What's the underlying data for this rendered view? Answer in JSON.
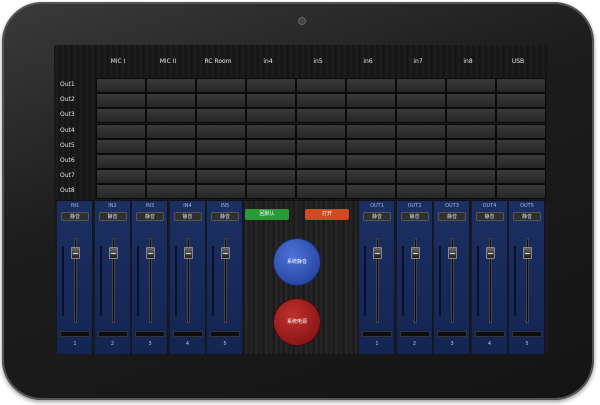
{
  "matrix": {
    "columns": [
      "MIC I",
      "MIC II",
      "RC Room",
      "in4",
      "in5",
      "in6",
      "in7",
      "in8",
      "USB"
    ],
    "rows": [
      "Out1",
      "Out2",
      "Out3",
      "Out4",
      "Out5",
      "Out6",
      "Out7",
      "Out8"
    ]
  },
  "inputs": [
    {
      "name": "IN1",
      "mute": "静音",
      "num": "1"
    },
    {
      "name": "IN2",
      "mute": "静音",
      "num": "2"
    },
    {
      "name": "IN3",
      "mute": "静音",
      "num": "3"
    },
    {
      "name": "IN4",
      "mute": "静音",
      "num": "4"
    },
    {
      "name": "IN5",
      "mute": "静音",
      "num": "5"
    }
  ],
  "outputs": [
    {
      "name": "OUT1",
      "mute": "静音",
      "num": "1"
    },
    {
      "name": "OUT2",
      "mute": "静音",
      "num": "2"
    },
    {
      "name": "OUT3",
      "mute": "静音",
      "num": "3"
    },
    {
      "name": "OUT4",
      "mute": "静音",
      "num": "4"
    },
    {
      "name": "OUT5",
      "mute": "静音",
      "num": "5"
    }
  ],
  "center": {
    "green_button": "回默认",
    "red_button": "打开",
    "system_mute": "系统静音",
    "system_power": "系统电源"
  },
  "colors": {
    "strip": "#1b2f62",
    "green": "#2a9a38",
    "orange": "#d04a22",
    "blue_circle": "#2a4aa8",
    "red_circle": "#8e1818"
  }
}
